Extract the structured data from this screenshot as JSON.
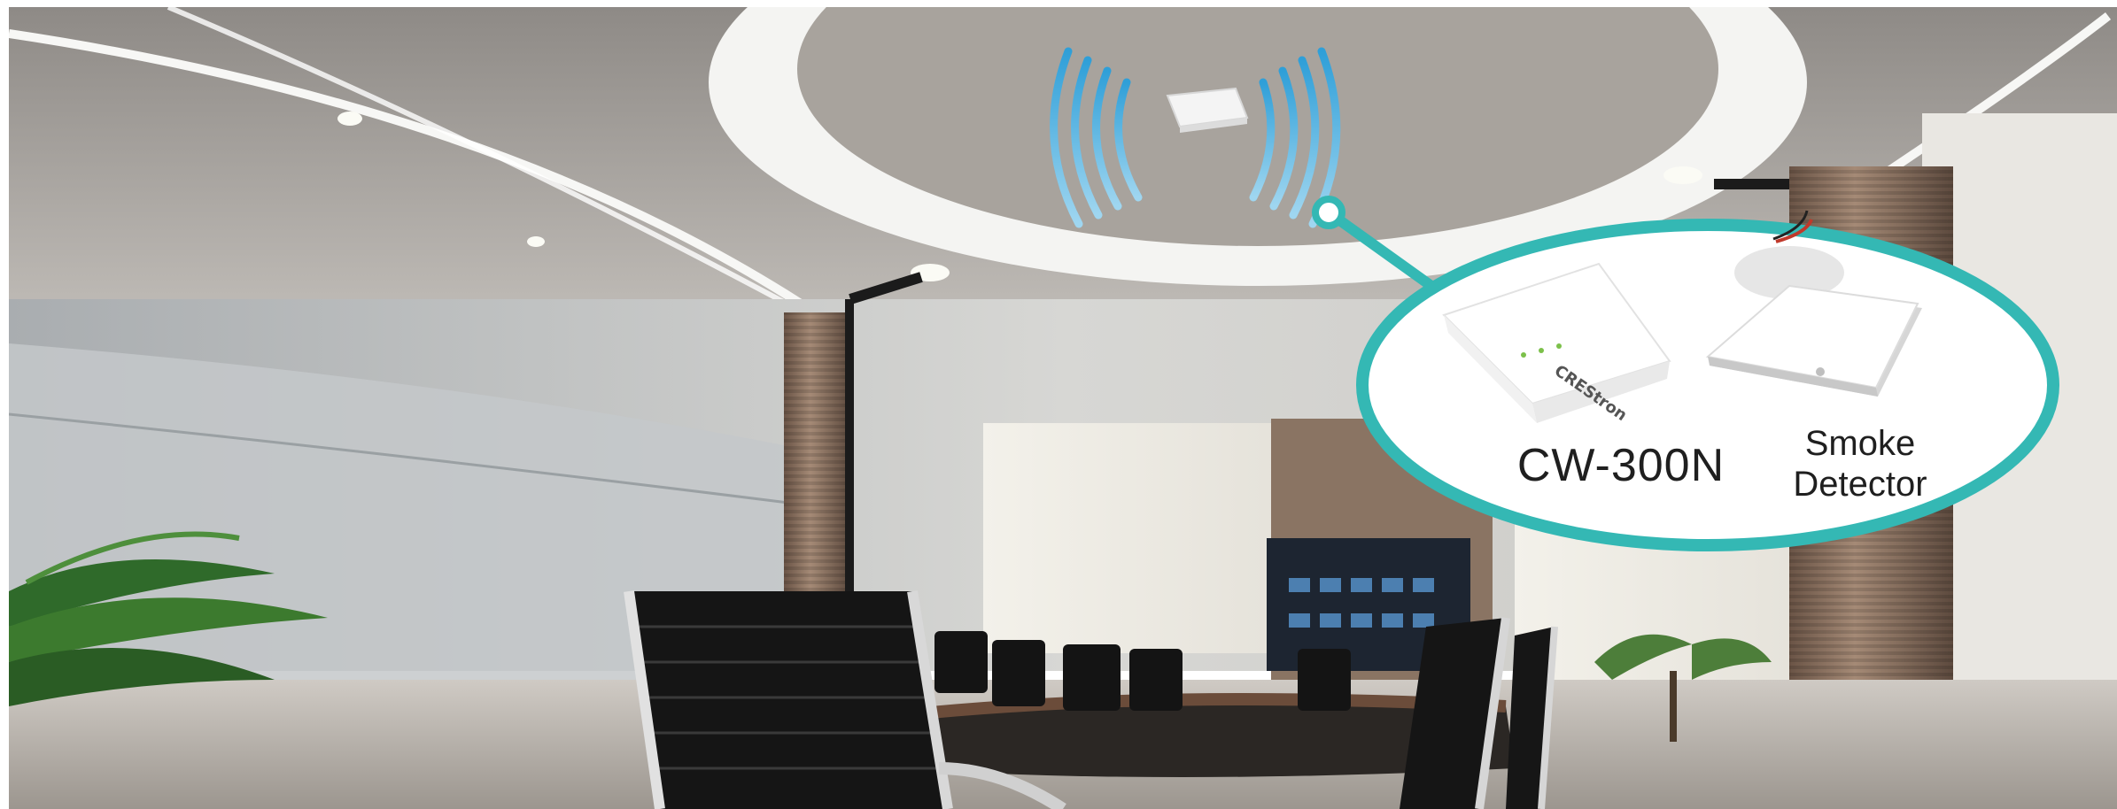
{
  "callout": {
    "device_model": "CW-300N",
    "detector_line1": "Smoke",
    "detector_line2": "Detector"
  },
  "device_logo": "CREStron",
  "colors": {
    "accent_teal": "#34b8b4",
    "signal_blue": "#3aa8de",
    "ceiling_grey": "#a9a49f",
    "wall_grey": "#b9b7b3"
  },
  "icons": {
    "signal_waves": "wifi-waves-icon",
    "router": "router-device",
    "smoke_detector": "smoke-detector-device"
  }
}
